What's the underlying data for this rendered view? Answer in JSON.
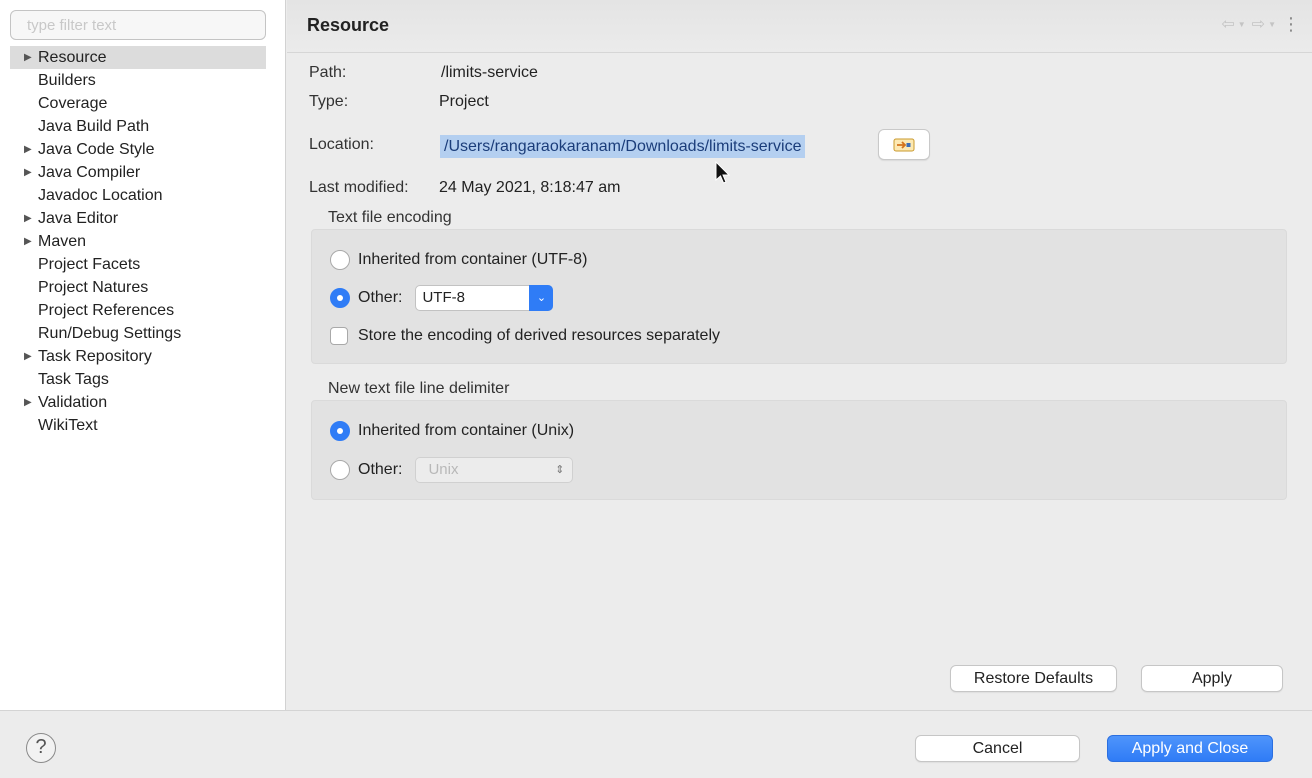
{
  "filter": {
    "placeholder": "type filter text"
  },
  "tree": {
    "items": [
      {
        "label": "Resource",
        "expandable": true,
        "selected": true
      },
      {
        "label": "Builders",
        "expandable": false
      },
      {
        "label": "Coverage",
        "expandable": false
      },
      {
        "label": "Java Build Path",
        "expandable": false
      },
      {
        "label": "Java Code Style",
        "expandable": true
      },
      {
        "label": "Java Compiler",
        "expandable": true
      },
      {
        "label": "Javadoc Location",
        "expandable": false
      },
      {
        "label": "Java Editor",
        "expandable": true
      },
      {
        "label": "Maven",
        "expandable": true
      },
      {
        "label": "Project Facets",
        "expandable": false
      },
      {
        "label": "Project Natures",
        "expandable": false
      },
      {
        "label": "Project References",
        "expandable": false
      },
      {
        "label": "Run/Debug Settings",
        "expandable": false
      },
      {
        "label": "Task Repository",
        "expandable": true
      },
      {
        "label": "Task Tags",
        "expandable": false
      },
      {
        "label": "Validation",
        "expandable": true
      },
      {
        "label": "WikiText",
        "expandable": false
      }
    ]
  },
  "page": {
    "title": "Resource",
    "path_label": "Path:",
    "path_value": "/limits-service",
    "type_label": "Type:",
    "type_value": "Project",
    "location_label": "Location:",
    "location_value": "/Users/rangaraokaranam/Downloads/limits-service",
    "modified_label": "Last modified:",
    "modified_value": "24 May 2021, 8:18:47 am"
  },
  "encoding": {
    "group_label": "Text file encoding",
    "inherited_label": "Inherited from container (UTF-8)",
    "other_label": "Other:",
    "other_value": "UTF-8",
    "selected": "other",
    "store_label": "Store the encoding of derived resources separately",
    "store_checked": false
  },
  "delimiter": {
    "group_label": "New text file line delimiter",
    "inherited_label": "Inherited from container (Unix)",
    "other_label": "Other:",
    "other_value": "Unix",
    "selected": "inherited"
  },
  "buttons": {
    "restore": "Restore Defaults",
    "apply": "Apply",
    "cancel": "Cancel",
    "apply_close": "Apply and Close"
  },
  "colors": {
    "accent": "#2f7cf6",
    "selection": "#b4cff0"
  },
  "icons": {
    "back": "back-arrow-icon",
    "forward": "forward-arrow-icon",
    "menu": "view-menu-icon",
    "help": "help-icon",
    "open_location": "open-location-icon"
  }
}
